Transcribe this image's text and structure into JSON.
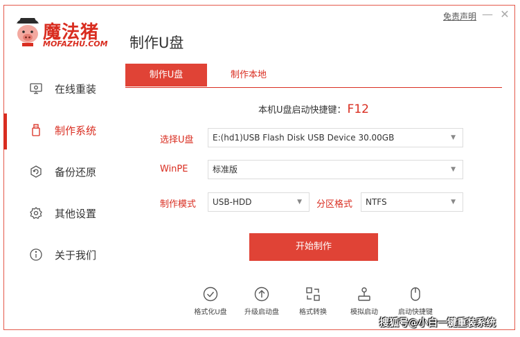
{
  "app": {
    "logo_cn": "魔法猪",
    "logo_en": "MOFAZHU.COM",
    "title": "制作U盘",
    "disclaimer": "免责声明",
    "minimize": "—",
    "close": "✕"
  },
  "sidebar": {
    "items": [
      {
        "label": "在线重装",
        "icon": "monitor-icon"
      },
      {
        "label": "制作系统",
        "icon": "usb-icon"
      },
      {
        "label": "备份还原",
        "icon": "backup-icon"
      },
      {
        "label": "其他设置",
        "icon": "gear-icon"
      },
      {
        "label": "关于我们",
        "icon": "info-icon"
      }
    ],
    "active": "制作系统"
  },
  "tabs": [
    {
      "label": "制作U盘"
    },
    {
      "label": "制作本地"
    }
  ],
  "hotkey": {
    "label": "本机U盘启动快捷键：",
    "key": "F12"
  },
  "form": {
    "usb_label": "选择U盘",
    "usb_value": "E:(hd1)USB Flash Disk USB Device 30.00GB",
    "winpe_label": "WinPE",
    "winpe_value": "标准版",
    "mode_label": "制作模式",
    "mode_value": "USB-HDD",
    "partition_label": "分区格式",
    "partition_value": "NTFS"
  },
  "start_button": "开始制作",
  "tools": [
    {
      "label": "格式化U盘",
      "icon": "check-circle-icon"
    },
    {
      "label": "升级启动盘",
      "icon": "upload-circle-icon"
    },
    {
      "label": "格式转换",
      "icon": "convert-icon"
    },
    {
      "label": "模拟启动",
      "icon": "joystick-icon"
    },
    {
      "label": "启动快捷键",
      "icon": "mouse-icon"
    }
  ],
  "watermark": "搜狐号@小白一键重装系统",
  "colors": {
    "accent": "#d92d20",
    "button": "#e04336",
    "border": "#e4584a"
  }
}
